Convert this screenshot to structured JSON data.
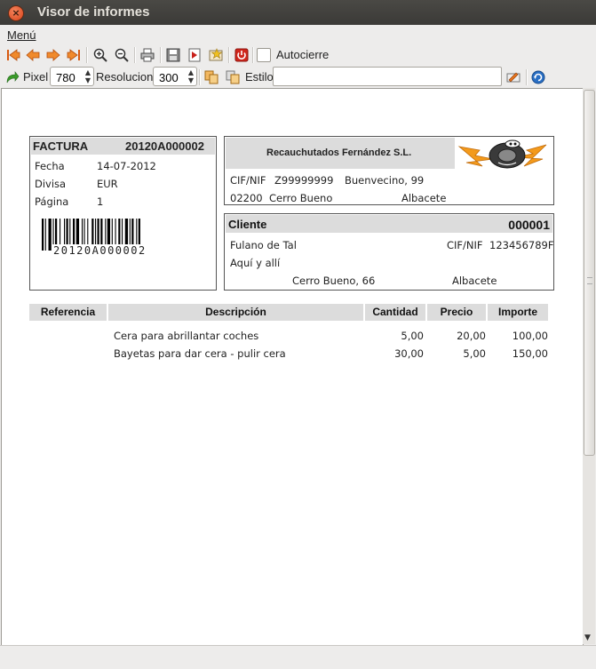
{
  "window": {
    "title": "Visor de informes",
    "close_glyph": "×"
  },
  "menubar": {
    "menu_label": "Menú"
  },
  "toolbar": {
    "autocierre_label": "Autocierre",
    "pixel_label": "Pixel",
    "pixel_value": "780",
    "resolucion_label": "Resolucion",
    "resolucion_value": "300",
    "estilo_label": "Estilo",
    "estilo_value": ""
  },
  "invoice": {
    "title": "FACTURA",
    "number": "20120A000002",
    "fields": [
      {
        "label": "Fecha",
        "value": "14-07-2012"
      },
      {
        "label": "Divisa",
        "value": "EUR"
      },
      {
        "label": "Página",
        "value": "1"
      }
    ],
    "barcode_text": "20120A000002"
  },
  "company": {
    "name": "Recauchutados Fernández S.L.",
    "cif_label": "CIF/NIF",
    "cif": "Z99999999",
    "address": "Buenvecino, 99",
    "postal_code": "02200",
    "city": "Cerro Bueno",
    "province": "Albacete"
  },
  "client": {
    "title": "Cliente",
    "code": "000001",
    "name": "Fulano de Tal",
    "cif_label": "CIF/NIF",
    "cif": "123456789F",
    "address_line": "Aquí y allí",
    "city": "Cerro Bueno, 66",
    "province": "Albacete"
  },
  "table": {
    "headers": [
      "Referencia",
      "Descripción",
      "Cantidad",
      "Precio",
      "Importe"
    ],
    "rows": [
      {
        "referencia": "",
        "descripcion": "Cera para abrillantar coches",
        "cantidad": "5,00",
        "precio": "20,00",
        "importe": "100,00"
      },
      {
        "referencia": "",
        "descripcion": "Bayetas para dar cera - pulir cera",
        "cantidad": "30,00",
        "precio": "5,00",
        "importe": "150,00"
      }
    ]
  },
  "colors": {
    "titlebar": "#3c3b37",
    "accent_orange": "#e8731a",
    "header_gray": "#dcdcdc"
  }
}
